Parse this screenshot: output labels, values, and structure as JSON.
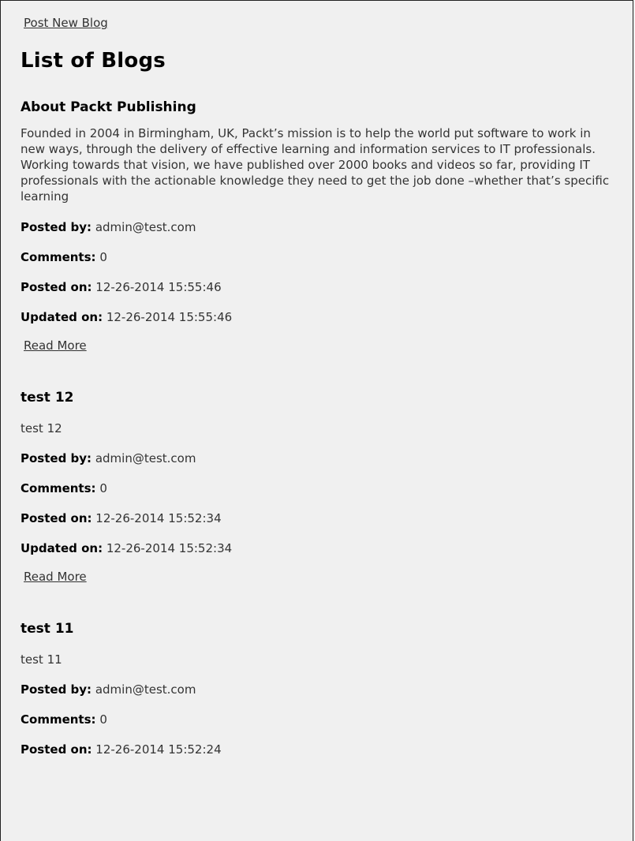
{
  "nav": {
    "post_new_blog": "Post New Blog"
  },
  "page_title": "List of Blogs",
  "labels": {
    "posted_by": "Posted by:",
    "comments": "Comments:",
    "posted_on": "Posted on:",
    "updated_on": "Updated on:",
    "read_more": "Read More"
  },
  "posts": [
    {
      "title": "About Packt Publishing",
      "body": "Founded in 2004 in Birmingham, UK, Packt’s mission is to help the world put software to work in new ways, through the delivery of effective learning and information services to IT professionals. Working towards that vision, we have published over 2000 books and videos so far, providing IT professionals with the actionable knowledge they need to get the job done –whether that’s specific learning",
      "posted_by": "admin@test.com",
      "comments": "0",
      "posted_on": "12-26-2014 15:55:46",
      "updated_on": "12-26-2014 15:55:46"
    },
    {
      "title": "test 12",
      "body": "test 12",
      "posted_by": "admin@test.com",
      "comments": "0",
      "posted_on": "12-26-2014 15:52:34",
      "updated_on": "12-26-2014 15:52:34"
    },
    {
      "title": "test 11",
      "body": "test 11",
      "posted_by": "admin@test.com",
      "comments": "0",
      "posted_on": "12-26-2014 15:52:24"
    }
  ]
}
